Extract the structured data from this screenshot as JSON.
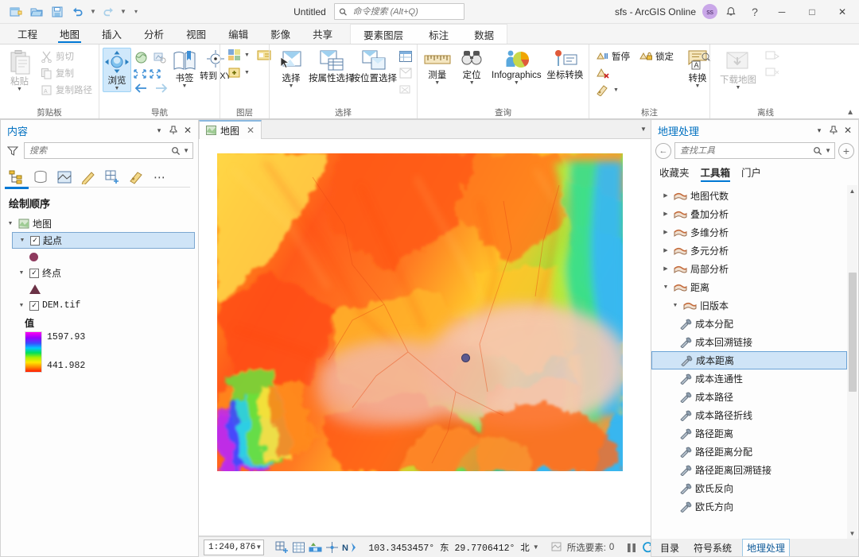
{
  "titlebar": {
    "quick_access": [
      {
        "name": "new-project-icon",
        "label": "新建工程"
      },
      {
        "name": "open-project-icon",
        "label": "打开工程"
      },
      {
        "name": "save-project-icon",
        "label": "保存工程"
      },
      {
        "name": "undo-icon",
        "label": "撤销"
      },
      {
        "name": "redo-icon",
        "label": "重做"
      },
      {
        "name": "customize-qat-icon",
        "label": "自定义快速访问工具栏"
      }
    ],
    "document_title": "Untitled",
    "search_placeholder": "命令搜索 (Alt+Q)",
    "account": "sfs - ArcGIS Online",
    "avatar_initials": "ss",
    "notifications_label": "通知",
    "help_label": "?",
    "minimize_label": "─",
    "maximize_label": "□",
    "close_label": "✕"
  },
  "ribbon": {
    "tabs": [
      {
        "label": "工程",
        "active": false
      },
      {
        "label": "地图",
        "active": true
      },
      {
        "label": "插入",
        "active": false
      },
      {
        "label": "分析",
        "active": false
      },
      {
        "label": "视图",
        "active": false
      },
      {
        "label": "编辑",
        "active": false
      },
      {
        "label": "影像",
        "active": false
      },
      {
        "label": "共享",
        "active": false
      }
    ],
    "contextual_tabs": [
      {
        "label": "要素图层"
      },
      {
        "label": "标注"
      },
      {
        "label": "数据"
      }
    ],
    "groups": [
      {
        "name": "clipboard",
        "label": "剪贴板",
        "big": [
          {
            "label": "粘贴",
            "icon": "paste-icon",
            "dropdown": true,
            "disabled": true
          }
        ],
        "small": [
          {
            "label": "剪切",
            "icon": "cut-icon",
            "disabled": true
          },
          {
            "label": "复制",
            "icon": "copy-icon",
            "disabled": true
          },
          {
            "label": "复制路径",
            "icon": "copy-path-icon",
            "disabled": true
          }
        ]
      },
      {
        "name": "navigate",
        "label": "导航",
        "big": [
          {
            "label": "浏览",
            "icon": "explore-icon",
            "dropdown": true,
            "selected": true
          },
          {
            "label": "书签",
            "icon": "bookmarks-icon",
            "dropdown": true
          },
          {
            "label": "转到 XY",
            "icon": "go-to-xy-icon",
            "dropdown": false
          }
        ]
      },
      {
        "name": "layer",
        "label": "图层",
        "small": [
          {
            "label": "",
            "icon": "basemap-icon"
          },
          {
            "label": "",
            "icon": "add-data-icon"
          }
        ]
      },
      {
        "name": "selection",
        "label": "选择",
        "big": [
          {
            "label": "选择",
            "icon": "select-icon",
            "dropdown": true
          },
          {
            "label": "按属性选择",
            "icon": "select-by-attributes-icon"
          },
          {
            "label": "按位置选择",
            "icon": "select-by-location-icon"
          }
        ]
      },
      {
        "name": "inquiry",
        "label": "查询",
        "big": [
          {
            "label": "测量",
            "icon": "measure-icon",
            "dropdown": true
          },
          {
            "label": "定位",
            "icon": "locate-icon",
            "dropdown": true
          },
          {
            "label": "Infographics",
            "icon": "infographics-icon",
            "dropdown": true
          },
          {
            "label": "坐标转换",
            "icon": "coordinate-conversion-icon"
          }
        ]
      },
      {
        "name": "labeling",
        "label": "标注",
        "small": [
          {
            "label": "暂停",
            "icon": "pause-labeling-icon"
          },
          {
            "label": "锁定",
            "icon": "lock-labeling-icon"
          },
          {
            "label": "",
            "icon": "clear-labeling-icon"
          },
          {
            "label": "",
            "icon": "label-style-icon"
          }
        ],
        "big": [
          {
            "label": "转换",
            "icon": "convert-labels-icon",
            "dropdown": true
          }
        ]
      },
      {
        "name": "offline",
        "label": "离线",
        "big": [
          {
            "label": "下载地图",
            "icon": "download-map-icon",
            "dropdown": true,
            "disabled": true
          }
        ],
        "small": [
          {
            "label": "",
            "icon": "sync-icon",
            "disabled": true
          },
          {
            "label": "",
            "icon": "remove-replica-icon",
            "disabled": true
          }
        ]
      }
    ]
  },
  "contents": {
    "title": "内容",
    "search_placeholder": "搜索",
    "tab_icons": [
      {
        "name": "list-by-drawing-order-icon",
        "active": true
      },
      {
        "name": "list-by-data-source-icon",
        "active": false
      },
      {
        "name": "list-by-selection-icon",
        "active": false
      },
      {
        "name": "list-by-editing-icon",
        "active": false
      },
      {
        "name": "list-by-snapping-icon",
        "active": false
      },
      {
        "name": "list-by-labeling-icon",
        "active": false
      },
      {
        "name": "more-options-icon",
        "active": false
      }
    ],
    "section_header": "绘制顺序",
    "tree": [
      {
        "label": "地图",
        "type": "map",
        "level": 0,
        "expanded": true
      },
      {
        "label": "起点",
        "type": "layer",
        "level": 1,
        "checked": true,
        "selected": true,
        "expanded": true,
        "symbol": "circle"
      },
      {
        "label": "终点",
        "type": "layer",
        "level": 1,
        "checked": true,
        "selected": false,
        "expanded": true,
        "symbol": "triangle"
      },
      {
        "label": "DEM.tif",
        "type": "raster",
        "level": 1,
        "checked": true,
        "selected": false,
        "expanded": true
      }
    ],
    "legend": {
      "title": "值",
      "max": "1597.93",
      "min": "441.982"
    }
  },
  "mapview": {
    "tab_label": "地图",
    "close_label": "✕"
  },
  "statusbar": {
    "scale": "1:240,876",
    "tools": [
      {
        "name": "map-grid-add-icon"
      },
      {
        "name": "map-grid-icon"
      },
      {
        "name": "map-scale-icon"
      },
      {
        "name": "map-crosshair-icon"
      },
      {
        "name": "map-north-icon"
      }
    ],
    "coordinates": "103.3453457° 东 29.7706412° 北",
    "selected_features_label": "所选要素:",
    "selected_features_count": "0",
    "pause_label": "⏸",
    "refresh_label": "⟳"
  },
  "geoprocessing": {
    "title": "地理处理",
    "back_label": "←",
    "search_placeholder": "查找工具",
    "add_label": "+",
    "tabs": [
      {
        "label": "收藏夹",
        "active": false
      },
      {
        "label": "工具箱",
        "active": true
      },
      {
        "label": "门户",
        "active": false
      }
    ],
    "tree": [
      {
        "label": "地图代数",
        "kind": "toolbox",
        "indent": 1,
        "expanded": false
      },
      {
        "label": "叠加分析",
        "kind": "toolbox",
        "indent": 1,
        "expanded": false
      },
      {
        "label": "多维分析",
        "kind": "toolbox",
        "indent": 1,
        "expanded": false
      },
      {
        "label": "多元分析",
        "kind": "toolbox",
        "indent": 1,
        "expanded": false
      },
      {
        "label": "局部分析",
        "kind": "toolbox",
        "indent": 1,
        "expanded": false
      },
      {
        "label": "距离",
        "kind": "toolbox",
        "indent": 1,
        "expanded": true
      },
      {
        "label": "旧版本",
        "kind": "toolbox",
        "indent": 2,
        "expanded": true
      },
      {
        "label": "成本分配",
        "kind": "tool",
        "indent": 3
      },
      {
        "label": "成本回溯链接",
        "kind": "tool",
        "indent": 3
      },
      {
        "label": "成本距离",
        "kind": "tool",
        "indent": 3,
        "selected": true
      },
      {
        "label": "成本连通性",
        "kind": "tool",
        "indent": 3
      },
      {
        "label": "成本路径",
        "kind": "tool",
        "indent": 3
      },
      {
        "label": "成本路径折线",
        "kind": "tool",
        "indent": 3
      },
      {
        "label": "路径距离",
        "kind": "tool",
        "indent": 3
      },
      {
        "label": "路径距离分配",
        "kind": "tool",
        "indent": 3
      },
      {
        "label": "路径距离回溯链接",
        "kind": "tool",
        "indent": 3
      },
      {
        "label": "欧氏反向",
        "kind": "tool",
        "indent": 3
      },
      {
        "label": "欧氏方向",
        "kind": "tool",
        "indent": 3
      }
    ],
    "bottom_tabs": [
      {
        "label": "目录",
        "active": false
      },
      {
        "label": "符号系统",
        "active": false
      },
      {
        "label": "地理处理",
        "active": true
      }
    ]
  },
  "colors": {
    "accent": "#0078d4",
    "selection": "#cfe4f7",
    "pane_title": "#0070c0",
    "start_point": "#5c5a8f",
    "end_point": "#6b3a46"
  }
}
